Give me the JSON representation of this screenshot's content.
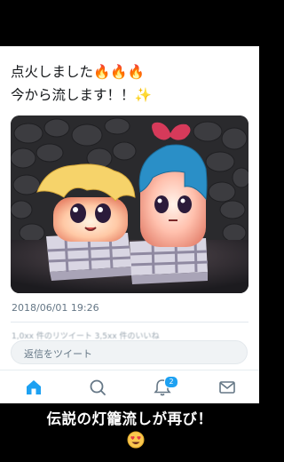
{
  "tweet": {
    "text_line1": "点火しました🔥🔥🔥",
    "text_line2": "今から流します！！✨",
    "timestamp": "2018/06/01 19:26",
    "stats_blurred": "1,0xx 件のリツイート 3,5xx 件のいいね"
  },
  "reply": {
    "placeholder": "返信をツイート"
  },
  "tabbar": {
    "items": [
      {
        "icon": "home-icon",
        "active": true
      },
      {
        "icon": "search-icon",
        "active": false
      },
      {
        "icon": "bell-icon",
        "active": false,
        "badge": "2"
      },
      {
        "icon": "mail-icon",
        "active": false
      }
    ]
  },
  "caption": {
    "text": "伝説の灯籠流しが再び！",
    "emoji": "heart-eyes-emoji"
  },
  "colors": {
    "accent": "#1da1f2",
    "text": "#14171a",
    "muted": "#657786",
    "background_frame": "#000000"
  }
}
